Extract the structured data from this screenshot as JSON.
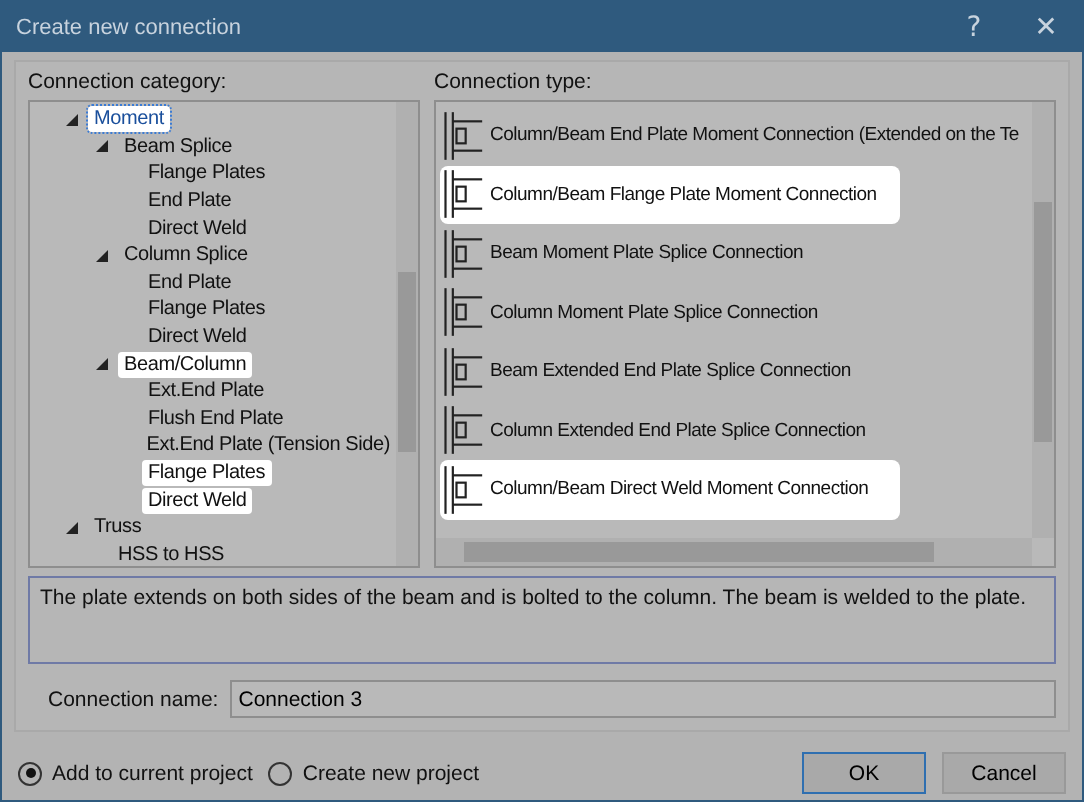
{
  "window": {
    "title": "Create new connection",
    "help": "?",
    "close": "✕"
  },
  "category": {
    "label": "Connection category:",
    "tree": [
      {
        "label": "Moment",
        "expanded": true,
        "selected": true,
        "highlighted": true,
        "children": [
          {
            "label": "Beam Splice",
            "expanded": true,
            "selected": false,
            "highlighted": false,
            "children": [
              {
                "label": "Flange Plates",
                "selected": false,
                "highlighted": false
              },
              {
                "label": "End Plate",
                "selected": false,
                "highlighted": false
              },
              {
                "label": "Direct Weld",
                "selected": false,
                "highlighted": false
              }
            ]
          },
          {
            "label": "Column Splice",
            "expanded": true,
            "selected": false,
            "highlighted": false,
            "children": [
              {
                "label": "End Plate",
                "selected": false,
                "highlighted": false
              },
              {
                "label": "Flange Plates",
                "selected": false,
                "highlighted": false
              },
              {
                "label": "Direct Weld",
                "selected": false,
                "highlighted": false
              }
            ]
          },
          {
            "label": "Beam/Column",
            "expanded": true,
            "selected": false,
            "highlighted": true,
            "children": [
              {
                "label": "Ext.End Plate",
                "selected": false,
                "highlighted": false
              },
              {
                "label": "Flush End Plate",
                "selected": false,
                "highlighted": false
              },
              {
                "label": "Ext.End Plate (Tension Side)",
                "selected": false,
                "highlighted": false
              },
              {
                "label": "Flange Plates",
                "selected": false,
                "highlighted": true
              },
              {
                "label": "Direct Weld",
                "selected": false,
                "highlighted": true
              }
            ]
          }
        ]
      },
      {
        "label": "Truss",
        "expanded": true,
        "selected": false,
        "highlighted": false,
        "children": [
          {
            "label": "HSS to HSS",
            "selected": false,
            "highlighted": false
          }
        ]
      }
    ]
  },
  "types": {
    "label": "Connection type:",
    "items": [
      {
        "label": "Column/Beam End Plate Moment Connection (Extended on the Te",
        "highlighted": false
      },
      {
        "label": "Column/Beam Flange Plate Moment Connection",
        "highlighted": true
      },
      {
        "label": "Beam Moment Plate Splice Connection",
        "highlighted": false
      },
      {
        "label": "Column Moment Plate Splice Connection",
        "highlighted": false
      },
      {
        "label": "Beam Extended End Plate Splice Connection",
        "highlighted": false
      },
      {
        "label": "Column Extended End Plate Splice Connection",
        "highlighted": false
      },
      {
        "label": "Column/Beam Direct Weld Moment Connection",
        "highlighted": true
      }
    ]
  },
  "description": "The plate extends on both sides of the beam and is bolted to the column.  The beam is welded to the plate.",
  "connection_name": {
    "label": "Connection name:",
    "value": "Connection 3"
  },
  "options": [
    {
      "label": "Add to current project",
      "selected": true
    },
    {
      "label": "Create new project",
      "selected": false
    }
  ],
  "buttons": [
    {
      "label": "OK",
      "focused": true
    },
    {
      "label": "Cancel",
      "focused": false
    }
  ]
}
